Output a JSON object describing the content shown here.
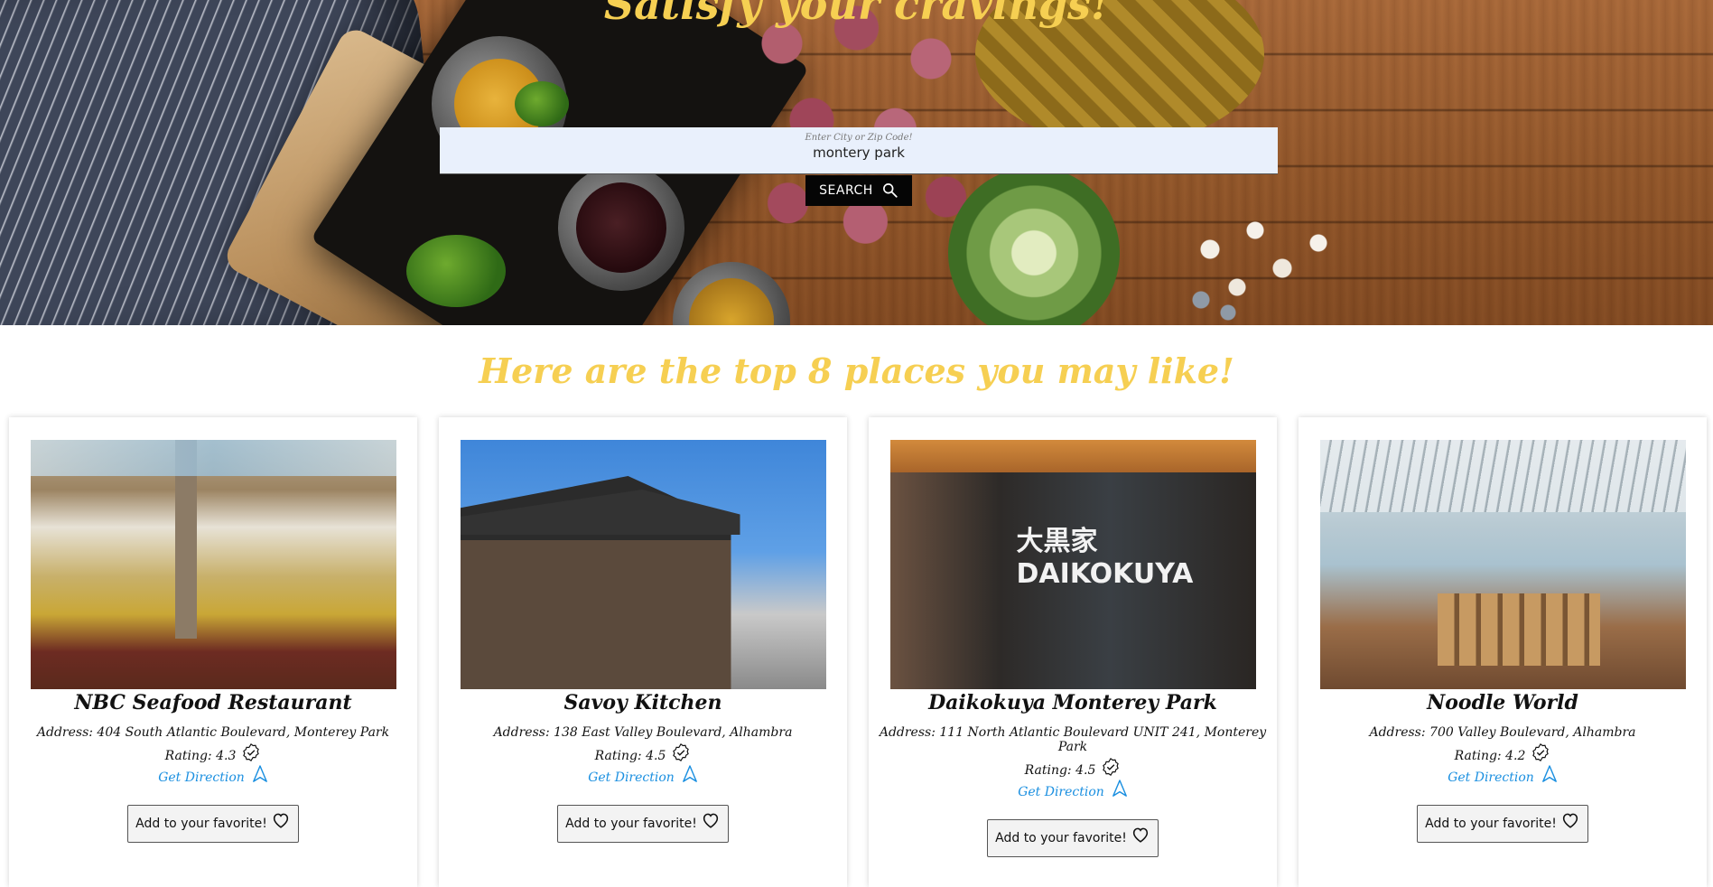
{
  "hero": {
    "title": "Satisfy your cravings!",
    "search_label": "Enter City or Zip Code!",
    "search_value": "montery park",
    "search_button": "SEARCH"
  },
  "section": {
    "title": "Here are the top 8 places you may like!"
  },
  "restaurants": [
    {
      "name": "NBC Seafood Restaurant",
      "address": "Address: 404 South Atlantic Boulevard, Monterey Park",
      "rating": "Rating: 4.3",
      "direction": "Get Direction",
      "favorite": "Add to your favorite!"
    },
    {
      "name": "Savoy Kitchen",
      "address": "Address: 138 East Valley Boulevard, Alhambra",
      "rating": "Rating: 4.5",
      "direction": "Get Direction",
      "favorite": "Add to your favorite!"
    },
    {
      "name": "Daikokuya Monterey Park",
      "address": "Address: 111 North Atlantic Boulevard UNIT 241, Monterey Park",
      "rating": "Rating: 4.5",
      "direction": "Get Direction",
      "favorite": "Add to your favorite!"
    },
    {
      "name": "Noodle World",
      "address": "Address: 700 Valley Boulevard, Alhambra",
      "rating": "Rating: 4.2",
      "direction": "Get Direction",
      "favorite": "Add to your favorite!"
    }
  ],
  "icons": {
    "search": "search-icon",
    "rating": "verified-badge-icon",
    "direction": "navigation-arrow-icon",
    "favorite": "heart-icon"
  },
  "colors": {
    "accent_yellow": "#f6cf52",
    "link_blue": "#1a8fe0",
    "search_bg": "#e9f0fc",
    "button_black": "#050505"
  }
}
